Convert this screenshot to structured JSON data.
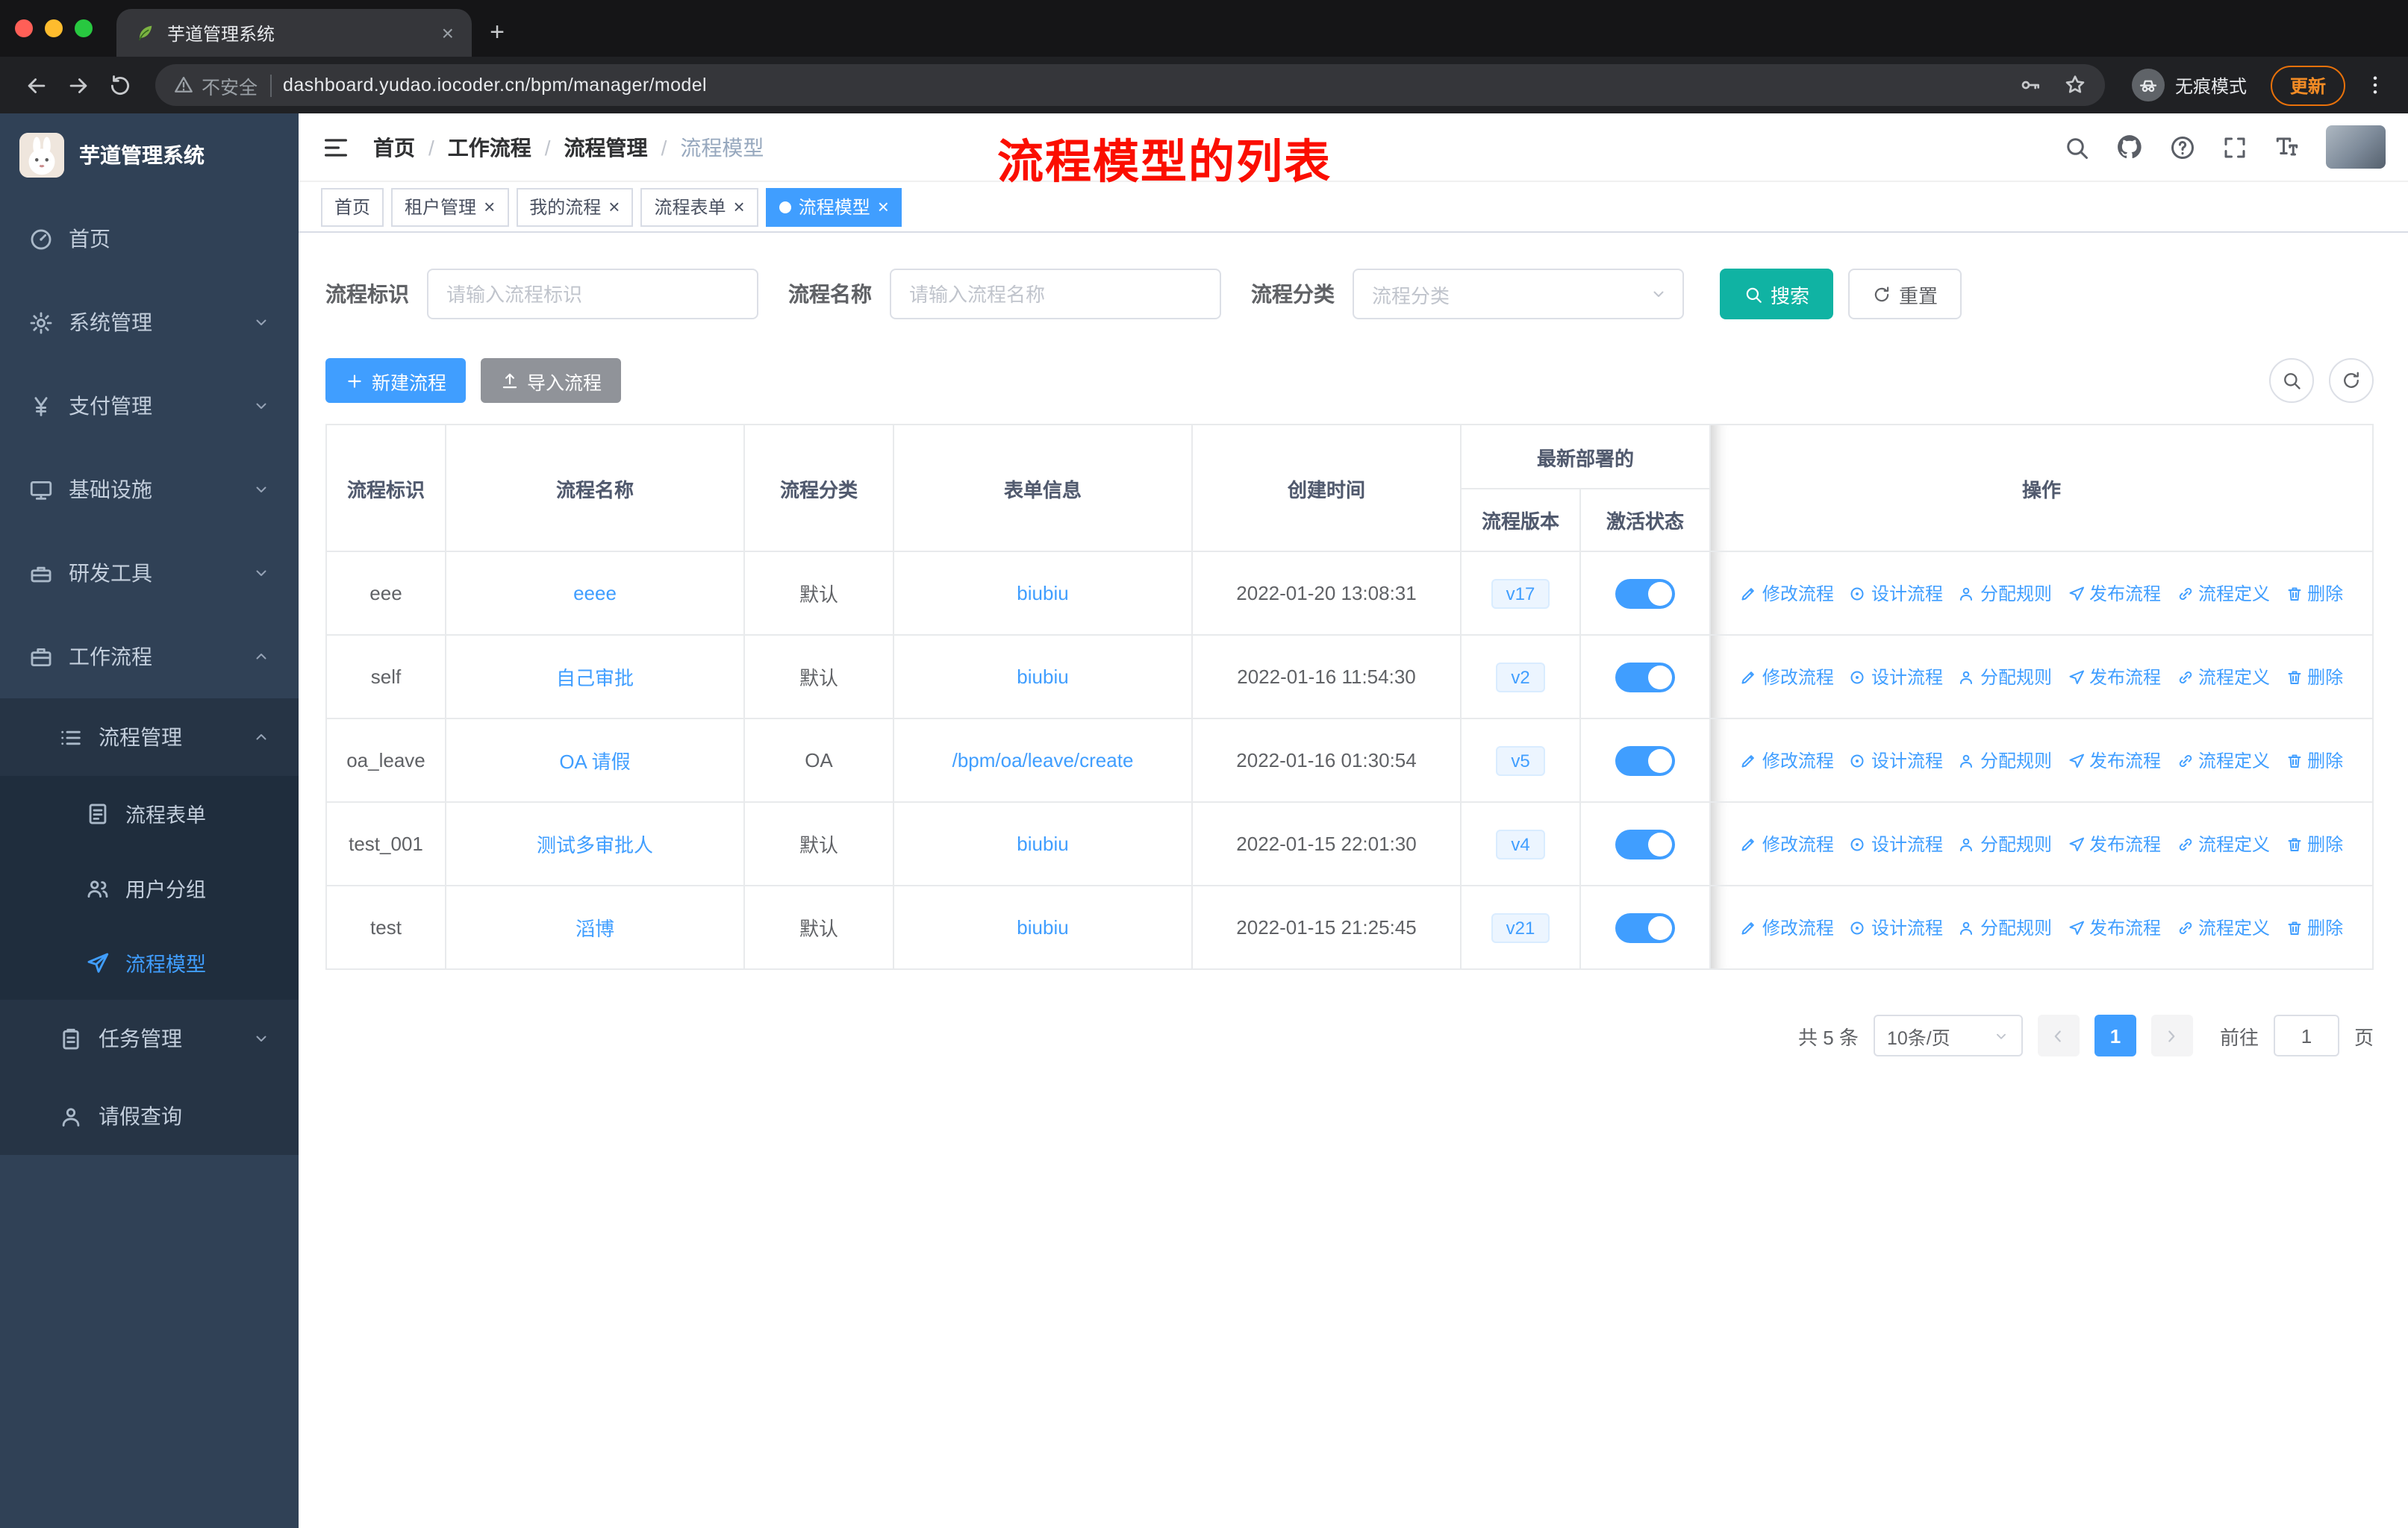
{
  "colors": {
    "accent_blue": "#409eff",
    "search_button_teal": "#10b3a3",
    "annotation_red": "#fb0e00",
    "sidebar_bg": "#304156",
    "sidebar_submenu_bg": "#1f2d3d",
    "toggle_on": "#409eff",
    "update_orange": "#f28b25",
    "traffic_lights": [
      "#ff5f57",
      "#febc2e",
      "#28c840"
    ]
  },
  "icons": {
    "favicon": "leaf-icon",
    "security": "warning-triangle-icon",
    "incognito": "incognito-icon",
    "search": "magnifier-icon",
    "refresh": "refresh-icon",
    "github": "github-icon",
    "help": "question-circle-icon",
    "fullscreen": "fullscreen-icon",
    "font_size": "font-size-icon"
  },
  "browser": {
    "tab_title": "芋道管理系统",
    "tab_close": "×",
    "new_tab": "+",
    "security_label": "不安全",
    "url": "dashboard.yudao.iocoder.cn/bpm/manager/model",
    "incognito_label": "无痕模式",
    "update_label": "更新"
  },
  "sidebar": {
    "logo": "芋道管理系统",
    "items": [
      {
        "label": "首页"
      },
      {
        "label": "系统管理"
      },
      {
        "label": "支付管理"
      },
      {
        "label": "基础设施"
      },
      {
        "label": "研发工具"
      },
      {
        "label": "工作流程"
      },
      {
        "label": "流程管理"
      },
      {
        "label": "流程表单"
      },
      {
        "label": "用户分组"
      },
      {
        "label": "流程模型"
      },
      {
        "label": "任务管理"
      },
      {
        "label": "请假查询"
      }
    ]
  },
  "header": {
    "breadcrumb": [
      "首页",
      "工作流程",
      "流程管理",
      "流程模型"
    ],
    "separator": "/",
    "annotation": "流程模型的列表"
  },
  "tags": [
    {
      "label": "首页"
    },
    {
      "label": "租户管理"
    },
    {
      "label": "我的流程"
    },
    {
      "label": "流程表单"
    },
    {
      "label": "流程模型"
    }
  ],
  "filters": {
    "id_label": "流程标识",
    "id_placeholder": "请输入流程标识",
    "name_label": "流程名称",
    "name_placeholder": "请输入流程名称",
    "category_label": "流程分类",
    "category_placeholder": "流程分类",
    "search": "搜索",
    "reset": "重置"
  },
  "toolbar": {
    "create": "新建流程",
    "import": "导入流程"
  },
  "table": {
    "columns": [
      "流程标识",
      "流程名称",
      "流程分类",
      "表单信息",
      "创建时间",
      "流程版本",
      "激活状态",
      "操作"
    ],
    "group_header": "最新部署的",
    "actions": [
      "修改流程",
      "设计流程",
      "分配规则",
      "发布流程",
      "流程定义",
      "删除"
    ],
    "rows": [
      {
        "id": "eee",
        "name": "eeee",
        "category": "默认",
        "form": "biubiu",
        "time": "2022-01-20 13:08:31",
        "version": "v17",
        "active": "on"
      },
      {
        "id": "self",
        "name": "自己审批",
        "category": "默认",
        "form": "biubiu",
        "time": "2022-01-16 11:54:30",
        "version": "v2",
        "active": "on"
      },
      {
        "id": "oa_leave",
        "name": "OA 请假",
        "category": "OA",
        "form": "/bpm/oa/leave/create",
        "time": "2022-01-16 01:30:54",
        "version": "v5",
        "active": "on"
      },
      {
        "id": "test_001",
        "name": "测试多审批人",
        "category": "默认",
        "form": "biubiu",
        "time": "2022-01-15 22:01:30",
        "version": "v4",
        "active": "on"
      },
      {
        "id": "test",
        "name": "滔博",
        "category": "默认",
        "form": "biubiu",
        "time": "2022-01-15 21:25:45",
        "version": "v21",
        "active": "on"
      }
    ]
  },
  "pagination": {
    "total": "共 5 条",
    "page_size": "10条/页",
    "current": "1",
    "goto_label": "前往",
    "goto_value": "1",
    "page_label": "页"
  }
}
